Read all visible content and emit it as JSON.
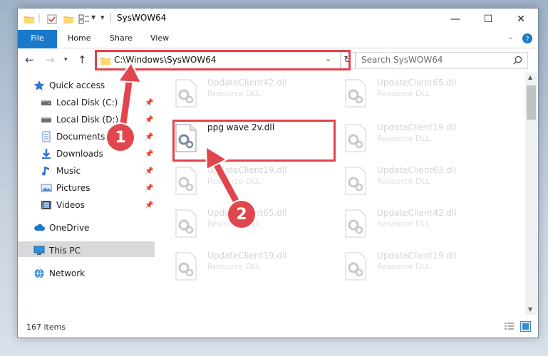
{
  "window": {
    "title": "SysWOW64",
    "minimize": "—",
    "maximize": "☐",
    "close": "✕"
  },
  "ribbon": {
    "tabs": [
      "File",
      "Home",
      "Share",
      "View"
    ]
  },
  "nav": {
    "address": "C:\\Windows\\SysWOW64",
    "search_placeholder": "Search SysWOW64"
  },
  "sidebar": {
    "items": [
      {
        "label": "Quick access",
        "icon": "star-icon"
      },
      {
        "label": "Local Disk (C:)",
        "icon": "drive-icon",
        "pinned": true
      },
      {
        "label": "Local Disk (D:)",
        "icon": "drive-icon",
        "pinned": true
      },
      {
        "label": "Documents",
        "icon": "documents-icon",
        "pinned": true
      },
      {
        "label": "Downloads",
        "icon": "download-icon",
        "pinned": true
      },
      {
        "label": "Music",
        "icon": "music-icon",
        "pinned": true
      },
      {
        "label": "Pictures",
        "icon": "pictures-icon",
        "pinned": true
      },
      {
        "label": "Videos",
        "icon": "videos-icon",
        "pinned": true
      },
      {
        "label": "OneDrive",
        "icon": "cloud-icon"
      },
      {
        "label": "This PC",
        "icon": "computer-icon",
        "selected": true
      },
      {
        "label": "Network",
        "icon": "network-icon"
      }
    ]
  },
  "files": [
    {
      "name": "UpdateClient42.dll",
      "desc": "Resource DLL"
    },
    {
      "name": "UpdateClient65.dll",
      "desc": "Resource DLL"
    },
    {
      "name": "ppg wave 2v.dll",
      "desc": ""
    },
    {
      "name": "UpdateClient19.dll",
      "desc": "Resource DLL"
    },
    {
      "name": "UpdateClient19.dll",
      "desc": "Resource DLL"
    },
    {
      "name": "UpdateClient63.dll",
      "desc": "Resource DLL"
    },
    {
      "name": "UpdateClient65.dll",
      "desc": "Resource DLL"
    },
    {
      "name": "UpdateClient42.dll",
      "desc": "Resource DLL"
    },
    {
      "name": "UpdateClient19.dll",
      "desc": "Resource DLL"
    },
    {
      "name": "UpdateClient19.dll",
      "desc": "Resource DLL"
    }
  ],
  "status": {
    "count": "167 items"
  },
  "annotations": {
    "step1": "1",
    "step2": "2"
  },
  "colors": {
    "accent": "#1979ca",
    "highlight": "#e1434b"
  }
}
